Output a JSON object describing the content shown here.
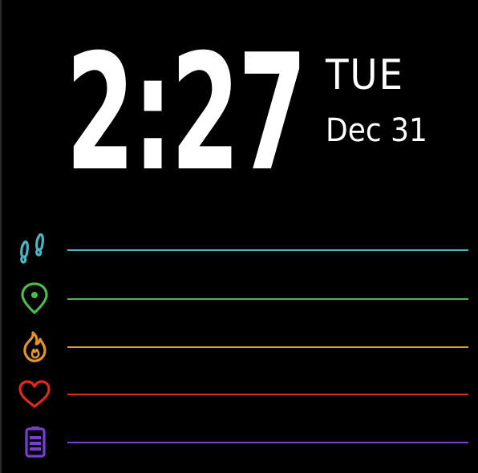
{
  "clock": {
    "time": "2:27",
    "weekday": "TUE",
    "date": "Dec 31"
  },
  "stats": [
    {
      "name": "steps",
      "icon": "footprints-icon",
      "color": "#4bb5c4"
    },
    {
      "name": "distance",
      "icon": "location-pin-icon",
      "color": "#4cbb4a"
    },
    {
      "name": "calories",
      "icon": "flame-icon",
      "color": "#e0962a"
    },
    {
      "name": "heart-rate",
      "icon": "heart-icon",
      "color": "#e02a1c"
    },
    {
      "name": "battery",
      "icon": "battery-icon",
      "color": "#7a3fd0"
    }
  ]
}
